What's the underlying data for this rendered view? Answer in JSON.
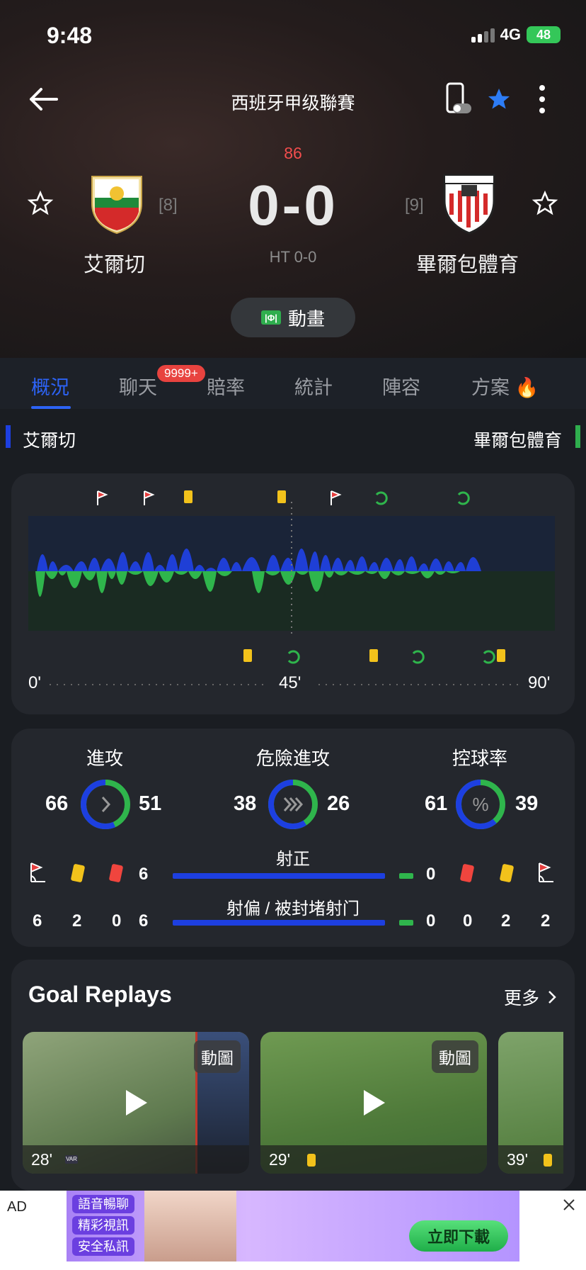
{
  "status": {
    "time": "9:48",
    "network": "4G",
    "battery": "48"
  },
  "header": {
    "league": "西班牙甲级聯賽"
  },
  "match": {
    "minute": "86",
    "score": "0-0",
    "halftime": "HT 0-0",
    "home": {
      "name": "艾爾切",
      "rank": "[8]"
    },
    "away": {
      "name": "畢爾包體育",
      "rank": "[9]"
    },
    "animation_label": "動畫"
  },
  "tabs": [
    {
      "label": "概況"
    },
    {
      "label": "聊天",
      "badge": "9999+"
    },
    {
      "label": "賠率"
    },
    {
      "label": "統計"
    },
    {
      "label": "陣容"
    },
    {
      "label": "方案"
    }
  ],
  "timeline": {
    "home_label": "艾爾切",
    "away_label": "畢爾包體育",
    "axis": [
      "0'",
      "45'",
      "90'"
    ]
  },
  "stats": {
    "attack": {
      "label": "進攻",
      "home": "66",
      "away": "51"
    },
    "dangerous": {
      "label": "危險進攻",
      "home": "38",
      "away": "26"
    },
    "possession": {
      "label": "控球率",
      "home": "61",
      "away": "39"
    },
    "on_target": {
      "label": "射正",
      "home": "6",
      "away": "0"
    },
    "off_target": {
      "label": "射偏 / 被封堵射门",
      "home": "6",
      "away": "0"
    },
    "home_corners": "6",
    "home_yellow": "2",
    "home_red": "0",
    "away_red": "0",
    "away_yellow": "2",
    "away_corners": "2"
  },
  "replays": {
    "title": "Goal Replays",
    "more": "更多",
    "items": [
      {
        "minute": "28'",
        "tag": "動圖"
      },
      {
        "minute": "29'",
        "tag": "動圖"
      },
      {
        "minute": "39'"
      }
    ]
  },
  "ad": {
    "label": "AD",
    "chips": [
      "語音暢聊",
      "精彩視訊",
      "安全私訊"
    ],
    "cta": "立即下載"
  },
  "colors": {
    "accent": "#2d63f5",
    "home": "#1d3fe0",
    "away": "#2fae4e",
    "live": "#f24d4d"
  }
}
